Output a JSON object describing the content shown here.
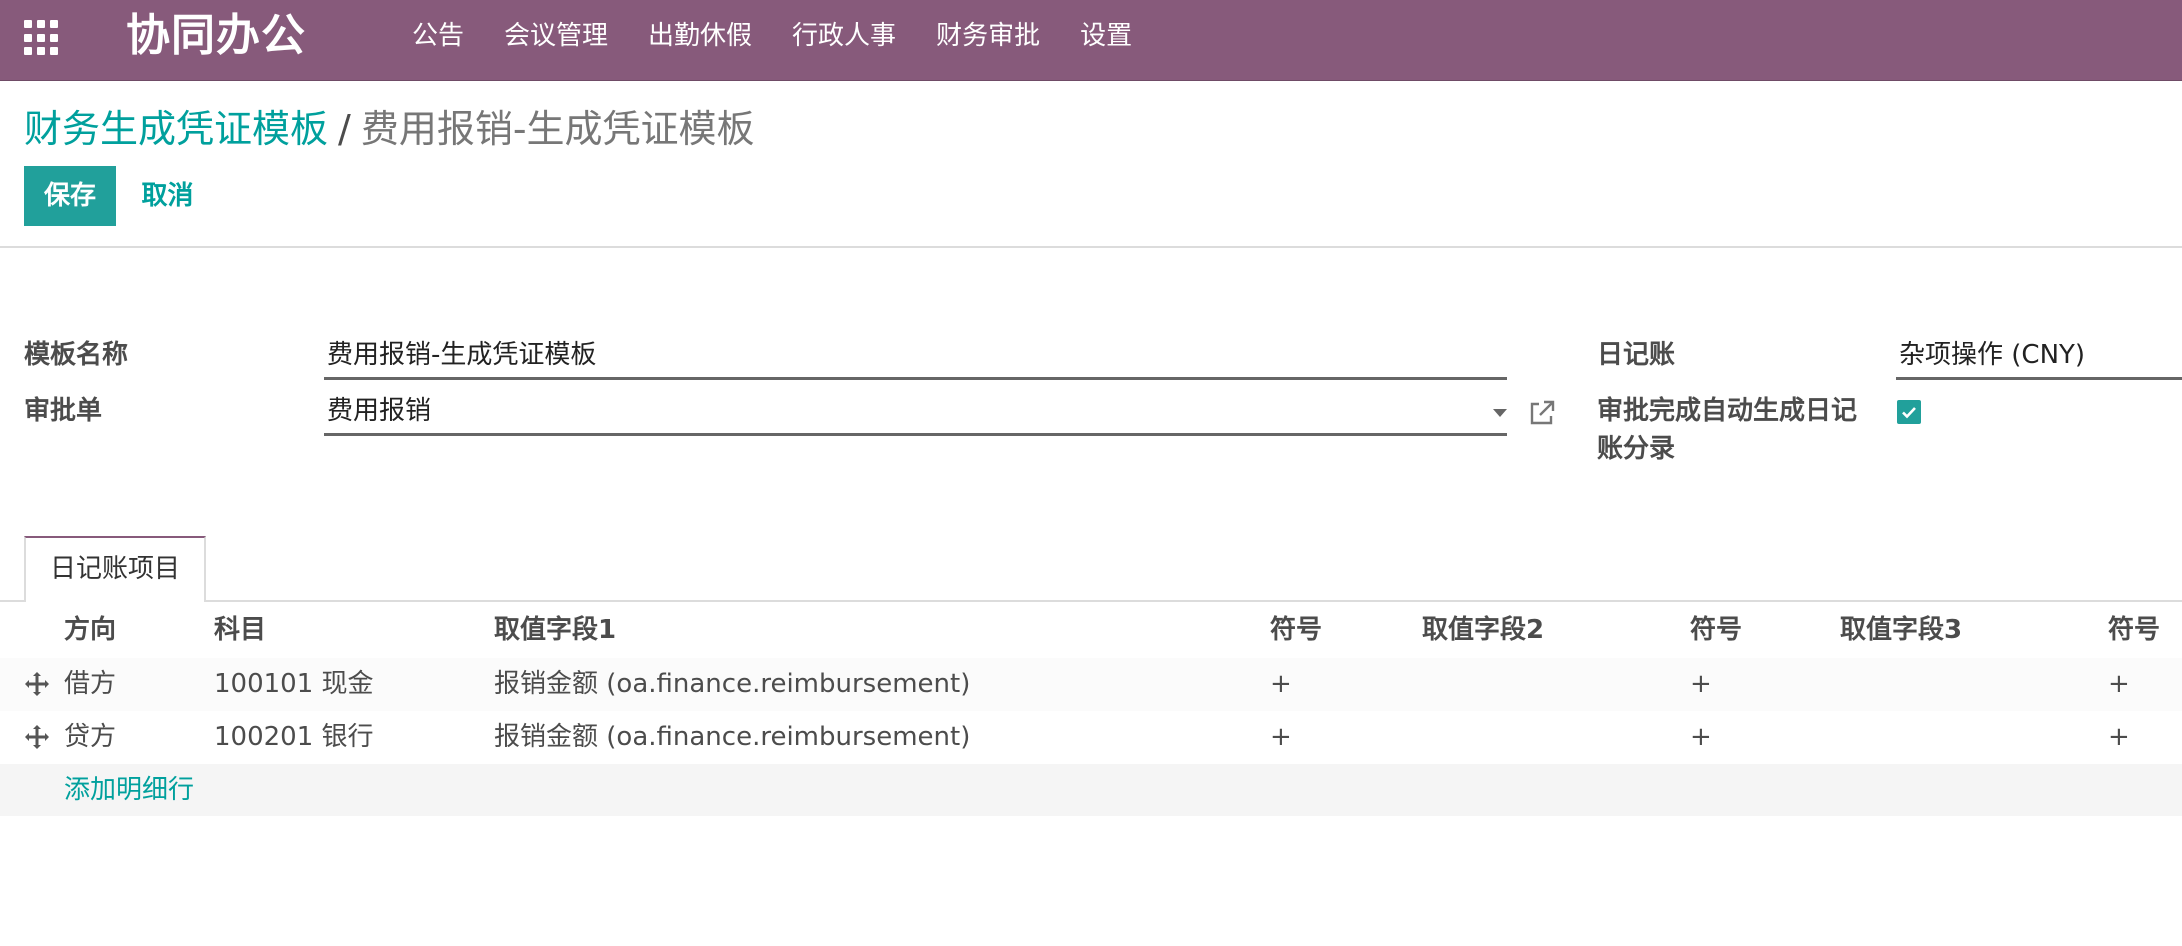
{
  "navbar": {
    "brand": "协同办公",
    "menu": [
      "公告",
      "会议管理",
      "出勤休假",
      "行政人事",
      "财务审批",
      "设置"
    ]
  },
  "breadcrumb": {
    "parent": "财务生成凭证模板",
    "separator": "/",
    "current": "费用报销-生成凭证模板"
  },
  "buttons": {
    "save": "保存",
    "cancel": "取消"
  },
  "form": {
    "template_name_label": "模板名称",
    "template_name_value": "费用报销-生成凭证模板",
    "approval_label": "审批单",
    "approval_value": "费用报销",
    "journal_label": "日记账",
    "journal_value": "杂项操作 (CNY)",
    "auto_entry_label_line1": "审批完成自动生成日记",
    "auto_entry_label_line2": "账分录",
    "auto_entry_checked": true
  },
  "tab": {
    "label": "日记账项目"
  },
  "table": {
    "headers": [
      "方向",
      "科目",
      "取值字段1",
      "符号",
      "取值字段2",
      "符号",
      "取值字段3",
      "符号"
    ],
    "rows": [
      {
        "direction": "借方",
        "account": "100101 现金",
        "field1": "报销金额 (oa.finance.reimbursement)",
        "sign1": "+",
        "field2": "",
        "sign2": "+",
        "field3": "",
        "sign3": "+"
      },
      {
        "direction": "贷方",
        "account": "100201 银行",
        "field1": "报销金额 (oa.finance.reimbursement)",
        "sign1": "+",
        "field2": "",
        "sign2": "+",
        "field3": "",
        "sign3": "+"
      }
    ],
    "add_line": "添加明细行"
  },
  "colors": {
    "navbar": "#875a7b",
    "accent": "#00A09D",
    "button": "#21a09b"
  }
}
